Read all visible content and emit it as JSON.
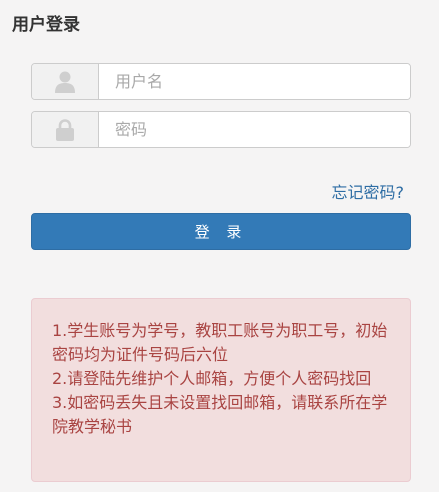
{
  "page": {
    "title": "用户登录"
  },
  "form": {
    "username_placeholder": "用户名",
    "password_placeholder": "密码",
    "username_icon": "user-icon",
    "password_icon": "lock-icon",
    "forgot_label": "忘记密码?",
    "login_label": "登 录"
  },
  "notice": {
    "lines": [
      "1.学生账号为学号，教职工账号为职工号，初始密码均为证件号码后六位",
      "2.请登陆先维护个人邮箱，方便个人密码找回",
      "3.如密码丢失且未设置找回邮箱，请联系所在学院教学秘书"
    ]
  },
  "colors": {
    "primary": "#337ab7",
    "link": "#2e6da4",
    "alert_bg": "#f2dede",
    "alert_text": "#a94442"
  }
}
